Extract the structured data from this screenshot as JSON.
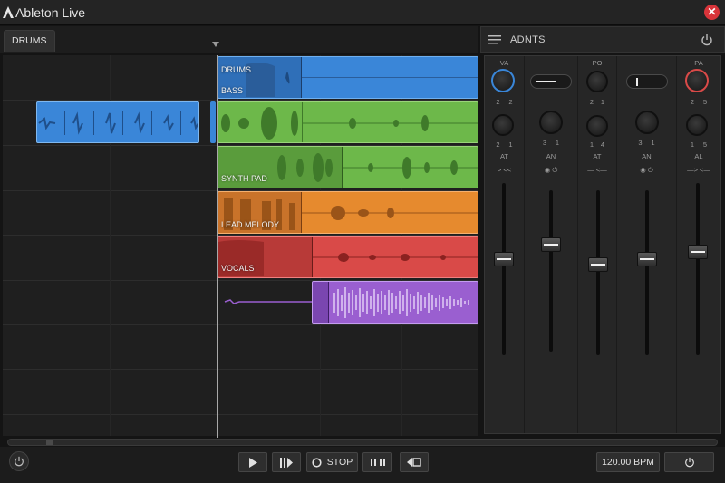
{
  "app": {
    "title": "Ableton Live",
    "close_label": "✕"
  },
  "tabs": [
    {
      "label": "DRUMS"
    }
  ],
  "mixer_header": {
    "title": "ADNTS"
  },
  "tracks": [
    {
      "name": "DRUMS",
      "color": "#3a86d8"
    },
    {
      "name": "BASS",
      "color": "#3a86d8"
    },
    {
      "name": "SYNTH PAD",
      "color": "#6db84a"
    },
    {
      "name": "LEAD MELODY",
      "color": "#e68a2e"
    },
    {
      "name": "VOCALS",
      "color": "#d94a48"
    },
    {
      "name": "",
      "color": "#9a5fd0"
    }
  ],
  "channels": [
    {
      "top_label": "VA",
      "accent": "#3a86d8",
      "knob_labels": [
        "2",
        "2"
      ],
      "knob2_labels": [
        "2",
        "1"
      ],
      "send_label": "AT",
      "mode_label": "> <<",
      "fader_level": 0.55
    },
    {
      "top_label": "",
      "accent": "#cccccc",
      "knob_labels": [
        "",
        ""
      ],
      "knob2_labels": [
        "3",
        "1"
      ],
      "send_label": "AN",
      "mode_label": "◉ ⏻",
      "fader_level": 0.6
    },
    {
      "top_label": "PO",
      "accent": "#cccccc",
      "knob_labels": [
        "2",
        "1"
      ],
      "knob2_labels": [
        "1",
        "4"
      ],
      "send_label": "AT",
      "mode_label": "— <—",
      "fader_level": 0.48
    },
    {
      "top_label": "",
      "accent": "#cccccc",
      "knob_labels": [
        "",
        ""
      ],
      "knob2_labels": [
        "3",
        "1"
      ],
      "send_label": "AN",
      "mode_label": "◉ ⏻",
      "fader_level": 0.5
    },
    {
      "top_label": "PA",
      "accent": "#d94a48",
      "knob_labels": [
        "2",
        "5"
      ],
      "knob2_labels": [
        "1",
        "5"
      ],
      "send_label": "AL",
      "mode_label": "—> <—",
      "fader_level": 0.54
    }
  ],
  "transport": {
    "stop_label": "STOP",
    "tempo": "120.00 BPM"
  }
}
